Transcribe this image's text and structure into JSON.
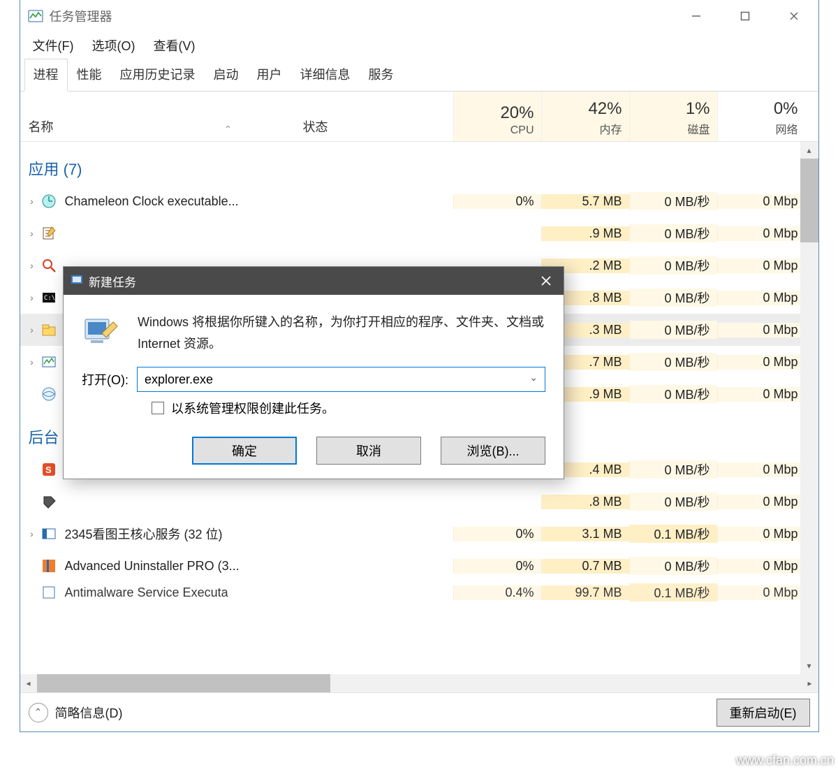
{
  "window": {
    "title": "任务管理器"
  },
  "menu": {
    "file": "文件(F)",
    "options": "选项(O)",
    "view": "查看(V)"
  },
  "tabs": {
    "t0": "进程",
    "t1": "性能",
    "t2": "应用历史记录",
    "t3": "启动",
    "t4": "用户",
    "t5": "详细信息",
    "t6": "服务",
    "active": 0
  },
  "headers": {
    "name": "名称",
    "status": "状态",
    "cpu_pct": "20%",
    "cpu_lbl": "CPU",
    "mem_pct": "42%",
    "mem_lbl": "内存",
    "disk_pct": "1%",
    "disk_lbl": "磁盘",
    "net_pct": "0%",
    "net_lbl": "网络"
  },
  "groups": {
    "apps_header": "应用 (7)",
    "bg_header": "后台"
  },
  "rows": {
    "r1_name": "Chameleon Clock executable...",
    "r1_cpu": "0%",
    "r1_mem": "5.7 MB",
    "r1_disk": "0 MB/秒",
    "r1_net": "0 Mbp",
    "r2_name": "",
    "r2_cpu": "",
    "r2_mem": ".9 MB",
    "r2_disk": "0 MB/秒",
    "r2_net": "0 Mbp",
    "r3_name": "",
    "r3_cpu": "",
    "r3_mem": ".2 MB",
    "r3_disk": "0 MB/秒",
    "r3_net": "0 Mbp",
    "r4_name": "",
    "r4_cpu": "",
    "r4_mem": ".8 MB",
    "r4_disk": "0 MB/秒",
    "r4_net": "0 Mbp",
    "r5_name": "",
    "r5_cpu": "",
    "r5_mem": ".3 MB",
    "r5_disk": "0 MB/秒",
    "r5_net": "0 Mbp",
    "r6_name": "",
    "r6_cpu": "",
    "r6_mem": ".7 MB",
    "r6_disk": "0 MB/秒",
    "r6_net": "0 Mbp",
    "r7_name": "",
    "r7_cpu": "",
    "r7_mem": ".9 MB",
    "r7_disk": "0 MB/秒",
    "r7_net": "0 Mbp",
    "b1_name": "",
    "b1_cpu": "",
    "b1_mem": ".4 MB",
    "b1_disk": "0 MB/秒",
    "b1_net": "0 Mbp",
    "b2_name": "",
    "b2_cpu": "",
    "b2_mem": ".8 MB",
    "b2_disk": "0 MB/秒",
    "b2_net": "0 Mbp",
    "b3_name": "2345看图王核心服务 (32 位)",
    "b3_cpu": "0%",
    "b3_mem": "3.1 MB",
    "b3_disk": "0.1 MB/秒",
    "b3_net": "0 Mbp",
    "b4_name": "Advanced Uninstaller PRO (3...",
    "b4_cpu": "0%",
    "b4_mem": "0.7 MB",
    "b4_disk": "0 MB/秒",
    "b4_net": "0 Mbp",
    "b5_name": "Antimalware Service Executa",
    "b5_cpu": "0.4%",
    "b5_mem": "99.7 MB",
    "b5_disk": "0.1 MB/秒",
    "b5_net": "0 Mbp"
  },
  "footer": {
    "fewer": "简略信息(D)",
    "action_btn": "重新启动(E)"
  },
  "dialog": {
    "title": "新建任务",
    "desc": "Windows 将根据你所键入的名称，为你打开相应的程序、文件夹、文档或 Internet 资源。",
    "open_label": "打开(O):",
    "open_value": "explorer.exe",
    "admin_label": "以系统管理权限创建此任务。",
    "ok": "确定",
    "cancel": "取消",
    "browse": "浏览(B)..."
  },
  "watermark": "www.cfan.com.cn"
}
